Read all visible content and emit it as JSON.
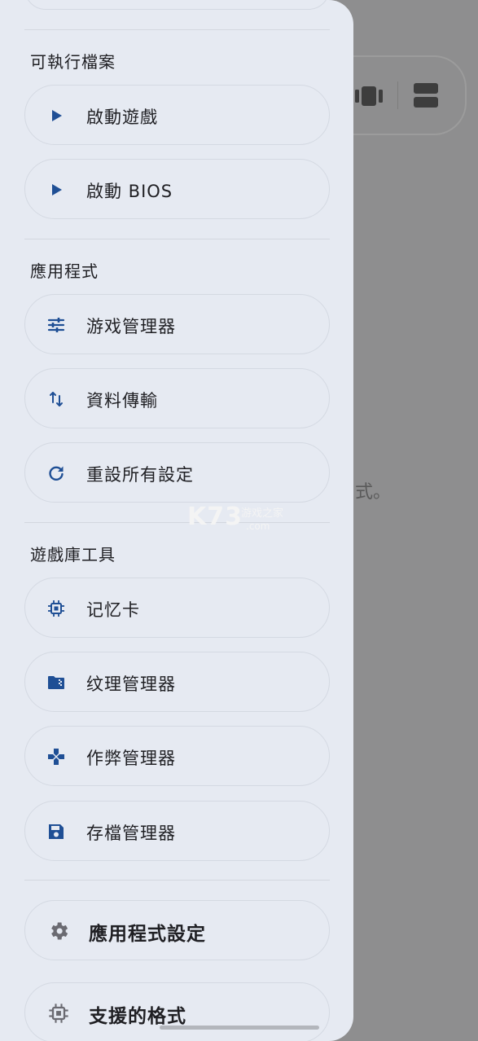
{
  "background": {
    "hint_text": "式。",
    "watermark": {
      "logo": "K73",
      "text": "游戏之家",
      "domain": ".com"
    }
  },
  "drawer": {
    "sections": [
      {
        "title": "可執行檔案",
        "items": [
          {
            "label": "啟動遊戲",
            "icon": "play-icon"
          },
          {
            "label": "啟動 BIOS",
            "icon": "play-icon"
          }
        ]
      },
      {
        "title": "應用程式",
        "items": [
          {
            "label": "游戏管理器",
            "icon": "sliders-icon"
          },
          {
            "label": "資料傳輸",
            "icon": "swap-vertical-icon"
          },
          {
            "label": "重設所有設定",
            "icon": "refresh-icon"
          }
        ]
      },
      {
        "title": "遊戲庫工具",
        "items": [
          {
            "label": "记忆卡",
            "icon": "chip-icon"
          },
          {
            "label": "纹理管理器",
            "icon": "folder-zip-icon"
          },
          {
            "label": "作弊管理器",
            "icon": "gamepad-icon"
          },
          {
            "label": "存檔管理器",
            "icon": "save-icon"
          }
        ]
      }
    ],
    "footer_items": [
      {
        "label": "應用程式設定",
        "icon": "gear-icon"
      },
      {
        "label": "支援的格式",
        "icon": "chip-icon"
      }
    ]
  },
  "colors": {
    "accent": "#1f4f95",
    "drawer_bg": "#e6eaf2",
    "scrim": "#8e8e8f"
  }
}
